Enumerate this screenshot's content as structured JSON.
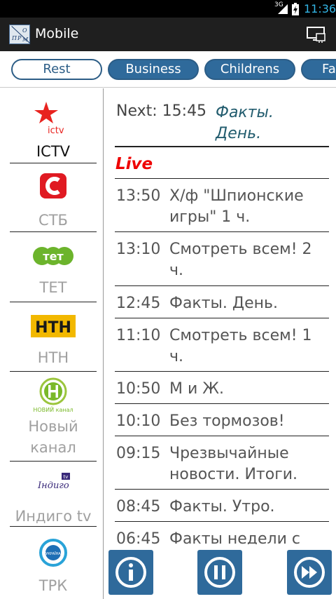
{
  "status_bar": {
    "network": "3G",
    "time": "11:36"
  },
  "app": {
    "title": "Mobile",
    "icon_letters": [
      "П",
      "Р",
      "О",
      "М"
    ]
  },
  "tabs": [
    {
      "label": "Rest",
      "active": true
    },
    {
      "label": "Business",
      "active": false
    },
    {
      "label": "Childrens",
      "active": false
    },
    {
      "label": "Fa",
      "active": false
    }
  ],
  "channels": [
    {
      "name": "ICTV",
      "logo": "ictv-logo",
      "active": true
    },
    {
      "name": "СТБ",
      "logo": "stb-logo",
      "active": false
    },
    {
      "name": "ТЕТ",
      "logo": "tet-logo",
      "active": false
    },
    {
      "name": "НТН",
      "logo": "ntn-logo",
      "active": false
    },
    {
      "name": "Новый канал",
      "logo": "novyi-kanal-logo",
      "active": false
    },
    {
      "name": "Индиго tv",
      "logo": "indigo-logo",
      "active": false
    },
    {
      "name": "ТРК",
      "logo": "trk-ukraina-logo",
      "active": false
    }
  ],
  "logo_text": {
    "ictv": "ictv",
    "tet": "тет",
    "ntn": "НТН",
    "novyi": "НОВИЙ канал",
    "indigo": "Індиго",
    "indigo_tv": "tv",
    "ukraina": "УКРАЇНА"
  },
  "next": {
    "label": "Next: 15:45",
    "title": "Факты. День."
  },
  "live_label": "Live",
  "programs": [
    {
      "time": "13:50",
      "title": "Х/ф \"Шпионские игры\"  1 ч."
    },
    {
      "time": "13:10",
      "title": "Смотреть всем!  2 ч."
    },
    {
      "time": "12:45",
      "title": "Факты. День."
    },
    {
      "time": "11:10",
      "title": "Смотреть всем!  1 ч."
    },
    {
      "time": "10:50",
      "title": "М и Ж."
    },
    {
      "time": "10:10",
      "title": "Без тормозов!"
    },
    {
      "time": "09:15",
      "title": "Чрезвычайные новости. Итоги."
    },
    {
      "time": "08:45",
      "title": "Факты. Утро."
    },
    {
      "time": "06:45",
      "title": "Факты недели с"
    }
  ],
  "buttons": {
    "info": "info-icon",
    "pause": "pause-icon",
    "forward": "fast-forward-icon"
  },
  "colors": {
    "accent": "#2f6a9b",
    "live": "#ee0000",
    "clock": "#33b5e5"
  }
}
